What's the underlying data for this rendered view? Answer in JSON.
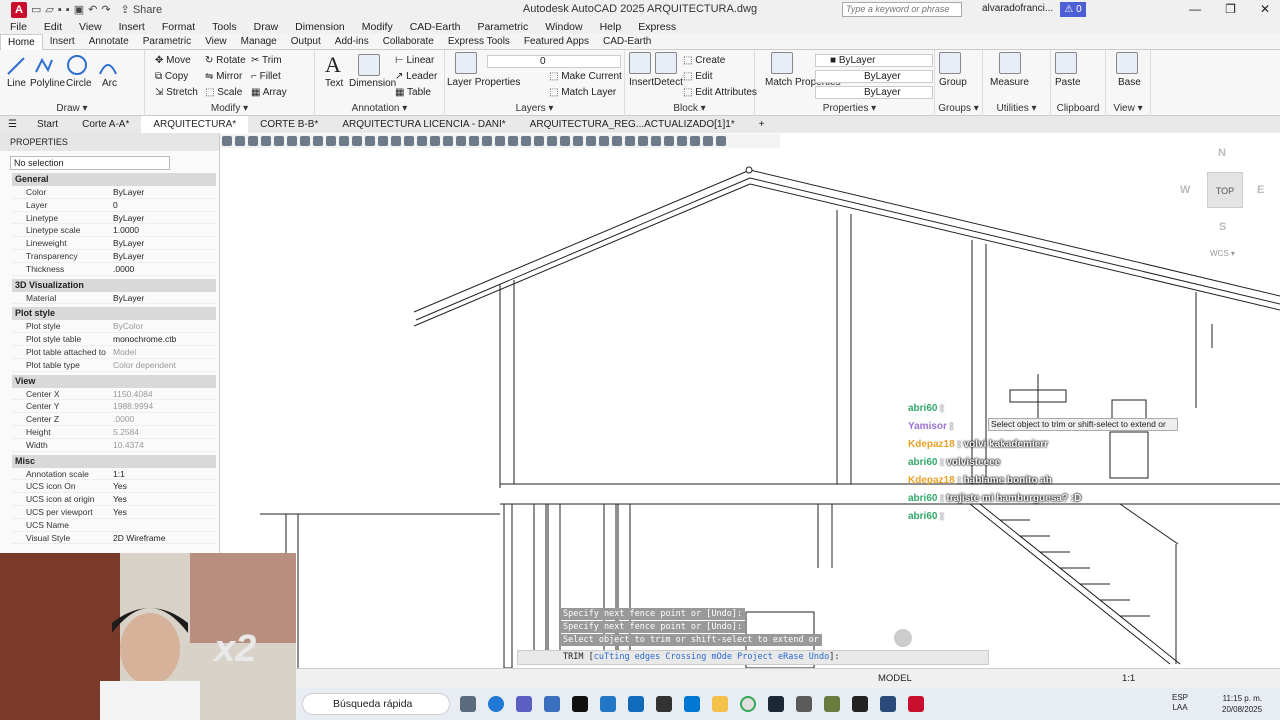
{
  "app": {
    "logo": "A",
    "title": "Autodesk AutoCAD 2025   ARQUITECTURA.dwg",
    "share_label": "Share",
    "search_placeholder": "Type a keyword or phrase",
    "user": "alvaradofranci...",
    "alert_count": "0"
  },
  "menu": [
    "File",
    "Edit",
    "View",
    "Insert",
    "Format",
    "Tools",
    "Draw",
    "Dimension",
    "Modify",
    "CAD-Earth",
    "Parametric",
    "Window",
    "Help",
    "Express"
  ],
  "ribbon_tabs": [
    "Home",
    "Insert",
    "Annotate",
    "Parametric",
    "View",
    "Manage",
    "Output",
    "Add-ins",
    "Collaborate",
    "Express Tools",
    "Featured Apps",
    "CAD-Earth"
  ],
  "ribbon": {
    "draw": {
      "title": "Draw",
      "tools": [
        "Line",
        "Polyline",
        "Circle",
        "Arc"
      ]
    },
    "modify": {
      "title": "Modify",
      "tools": [
        "Move",
        "Rotate",
        "Trim",
        "Copy",
        "Mirror",
        "Fillet",
        "Stretch",
        "Scale",
        "Array"
      ]
    },
    "annotation": {
      "title": "Annotation",
      "tools": [
        "Text",
        "Dimension",
        "Linear",
        "Leader",
        "Table"
      ]
    },
    "layers": {
      "title": "Layers",
      "tools": [
        "Layer Properties",
        "Make Current",
        "Match Layer"
      ],
      "current_layer": "0"
    },
    "block": {
      "title": "Block",
      "tools": [
        "Insert",
        "Detect",
        "Create",
        "Edit",
        "Edit Attributes"
      ]
    },
    "properties": {
      "title": "Properties",
      "tools": [
        "Match Properties"
      ],
      "color": "ByLayer",
      "linetype": "ByLayer",
      "lineweight": "ByLayer"
    },
    "groups": {
      "title": "Groups",
      "tools": [
        "Group"
      ]
    },
    "utilities": {
      "title": "Utilities",
      "tools": [
        "Measure"
      ]
    },
    "clipboard": {
      "title": "Clipboard",
      "tools": [
        "Paste"
      ]
    },
    "view": {
      "title": "View",
      "tools": [
        "Base"
      ]
    }
  },
  "doc_tabs": [
    "Start",
    "Corte A-A*",
    "ARQUITECTURA*",
    "CORTE B-B*",
    "ARQUITECTURA LICENCIA - DANI*",
    "ARQUITECTURA_REG...ACTUALIZADO[1]1*"
  ],
  "properties": {
    "header": "PROPERTIES",
    "selection": "No selection",
    "sections": [
      {
        "title": "General",
        "rows": [
          {
            "k": "Color",
            "v": "ByLayer"
          },
          {
            "k": "Layer",
            "v": "0"
          },
          {
            "k": "Linetype",
            "v": "ByLayer"
          },
          {
            "k": "Linetype scale",
            "v": "1.0000"
          },
          {
            "k": "Lineweight",
            "v": "ByLayer"
          },
          {
            "k": "Transparency",
            "v": "ByLayer"
          },
          {
            "k": "Thickness",
            "v": ".0000"
          }
        ]
      },
      {
        "title": "3D Visualization",
        "rows": [
          {
            "k": "Material",
            "v": "ByLayer"
          }
        ]
      },
      {
        "title": "Plot style",
        "rows": [
          {
            "k": "Plot style",
            "v": "ByColor",
            "grey": true
          },
          {
            "k": "Plot style table",
            "v": "monochrome.ctb"
          },
          {
            "k": "Plot table attached to",
            "v": "Model",
            "grey": true
          },
          {
            "k": "Plot table type",
            "v": "Color dependent",
            "grey": true
          }
        ]
      },
      {
        "title": "View",
        "rows": [
          {
            "k": "Center X",
            "v": "1150.4084",
            "grey": true
          },
          {
            "k": "Center Y",
            "v": "1988.9994",
            "grey": true
          },
          {
            "k": "Center Z",
            "v": ".0000",
            "grey": true
          },
          {
            "k": "Height",
            "v": "5.2584",
            "grey": true
          },
          {
            "k": "Width",
            "v": "10.4374",
            "grey": true
          }
        ]
      },
      {
        "title": "Misc",
        "rows": [
          {
            "k": "Annotation scale",
            "v": "1:1"
          },
          {
            "k": "UCS icon On",
            "v": "Yes"
          },
          {
            "k": "UCS icon at origin",
            "v": "Yes"
          },
          {
            "k": "UCS per viewport",
            "v": "Yes"
          },
          {
            "k": "UCS Name",
            "v": ""
          },
          {
            "k": "Visual Style",
            "v": "2D Wireframe"
          }
        ]
      }
    ]
  },
  "viewcube": {
    "top": "TOP",
    "n": "N",
    "s": "S",
    "e": "E",
    "w": "W",
    "wcs": "WCS"
  },
  "chat": [
    {
      "user": "abri60",
      "msg": ":",
      "color": "n1"
    },
    {
      "user": "Yamisor",
      "msg": ":",
      "color": "n3"
    },
    {
      "user": "Kdepaz18",
      "msg": ": volvi kakademierr",
      "color": "n2"
    },
    {
      "user": "abri60",
      "msg": ": volvisteeee",
      "color": "n1"
    },
    {
      "user": "Kdepaz18",
      "msg": ": hablame bonito ah",
      "color": "n2"
    },
    {
      "user": "abri60",
      "msg": ": trajiste mi hamburguesa? :D",
      "color": "n1"
    },
    {
      "user": "abri60",
      "msg": ":",
      "color": "n1"
    }
  ],
  "tooltip": "Select object to trim or shift-select to extend or",
  "command_history": [
    "Specify next fence point or [Undo]:",
    "Specify next fence point or [Undo]:",
    "Select object to trim or shift-select to extend or"
  ],
  "command_line": {
    "prefix": "TRIM",
    "options": [
      "cuTting edges",
      "Crossing",
      "mOde",
      "Project",
      "eRase",
      "Undo"
    ]
  },
  "overlay_text": "x2",
  "status": {
    "model": "MODEL",
    "scale": "1:1"
  },
  "taskbar": {
    "search": "Búsqueda rápida",
    "lang": "ESP",
    "lang2": "LAA",
    "time": "11:15 p. m.",
    "date": "20/08/2025"
  }
}
